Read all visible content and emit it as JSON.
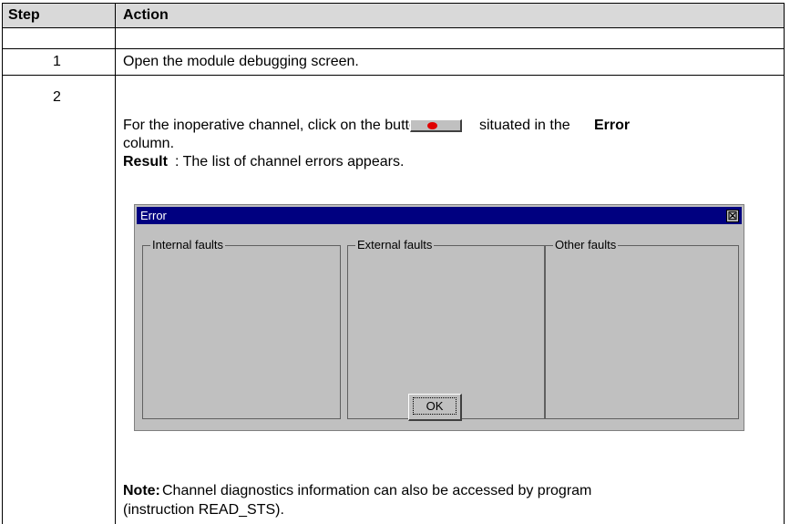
{
  "table": {
    "headers": {
      "step": "Step",
      "action": "Action"
    },
    "rows": [
      {
        "step": "1",
        "text": "Open the module debugging screen."
      },
      {
        "step": "2",
        "line1": "For the inoperative channel, click on the button",
        "line1_after": "situated in the",
        "line1_bold": "Error",
        "line2": "column.",
        "result_label": "Result",
        "result_text": ": The list of channel errors appears.",
        "note_label": "Note:",
        "note_text": " Channel diagnostics information can also be accessed by program",
        "note_line2": "(instruction READ_STS)."
      }
    ]
  },
  "dialog": {
    "title": "Error",
    "close_glyph": "☒",
    "groups": [
      "Internal faults",
      "External faults",
      "Other faults"
    ],
    "ok_label": "OK"
  }
}
